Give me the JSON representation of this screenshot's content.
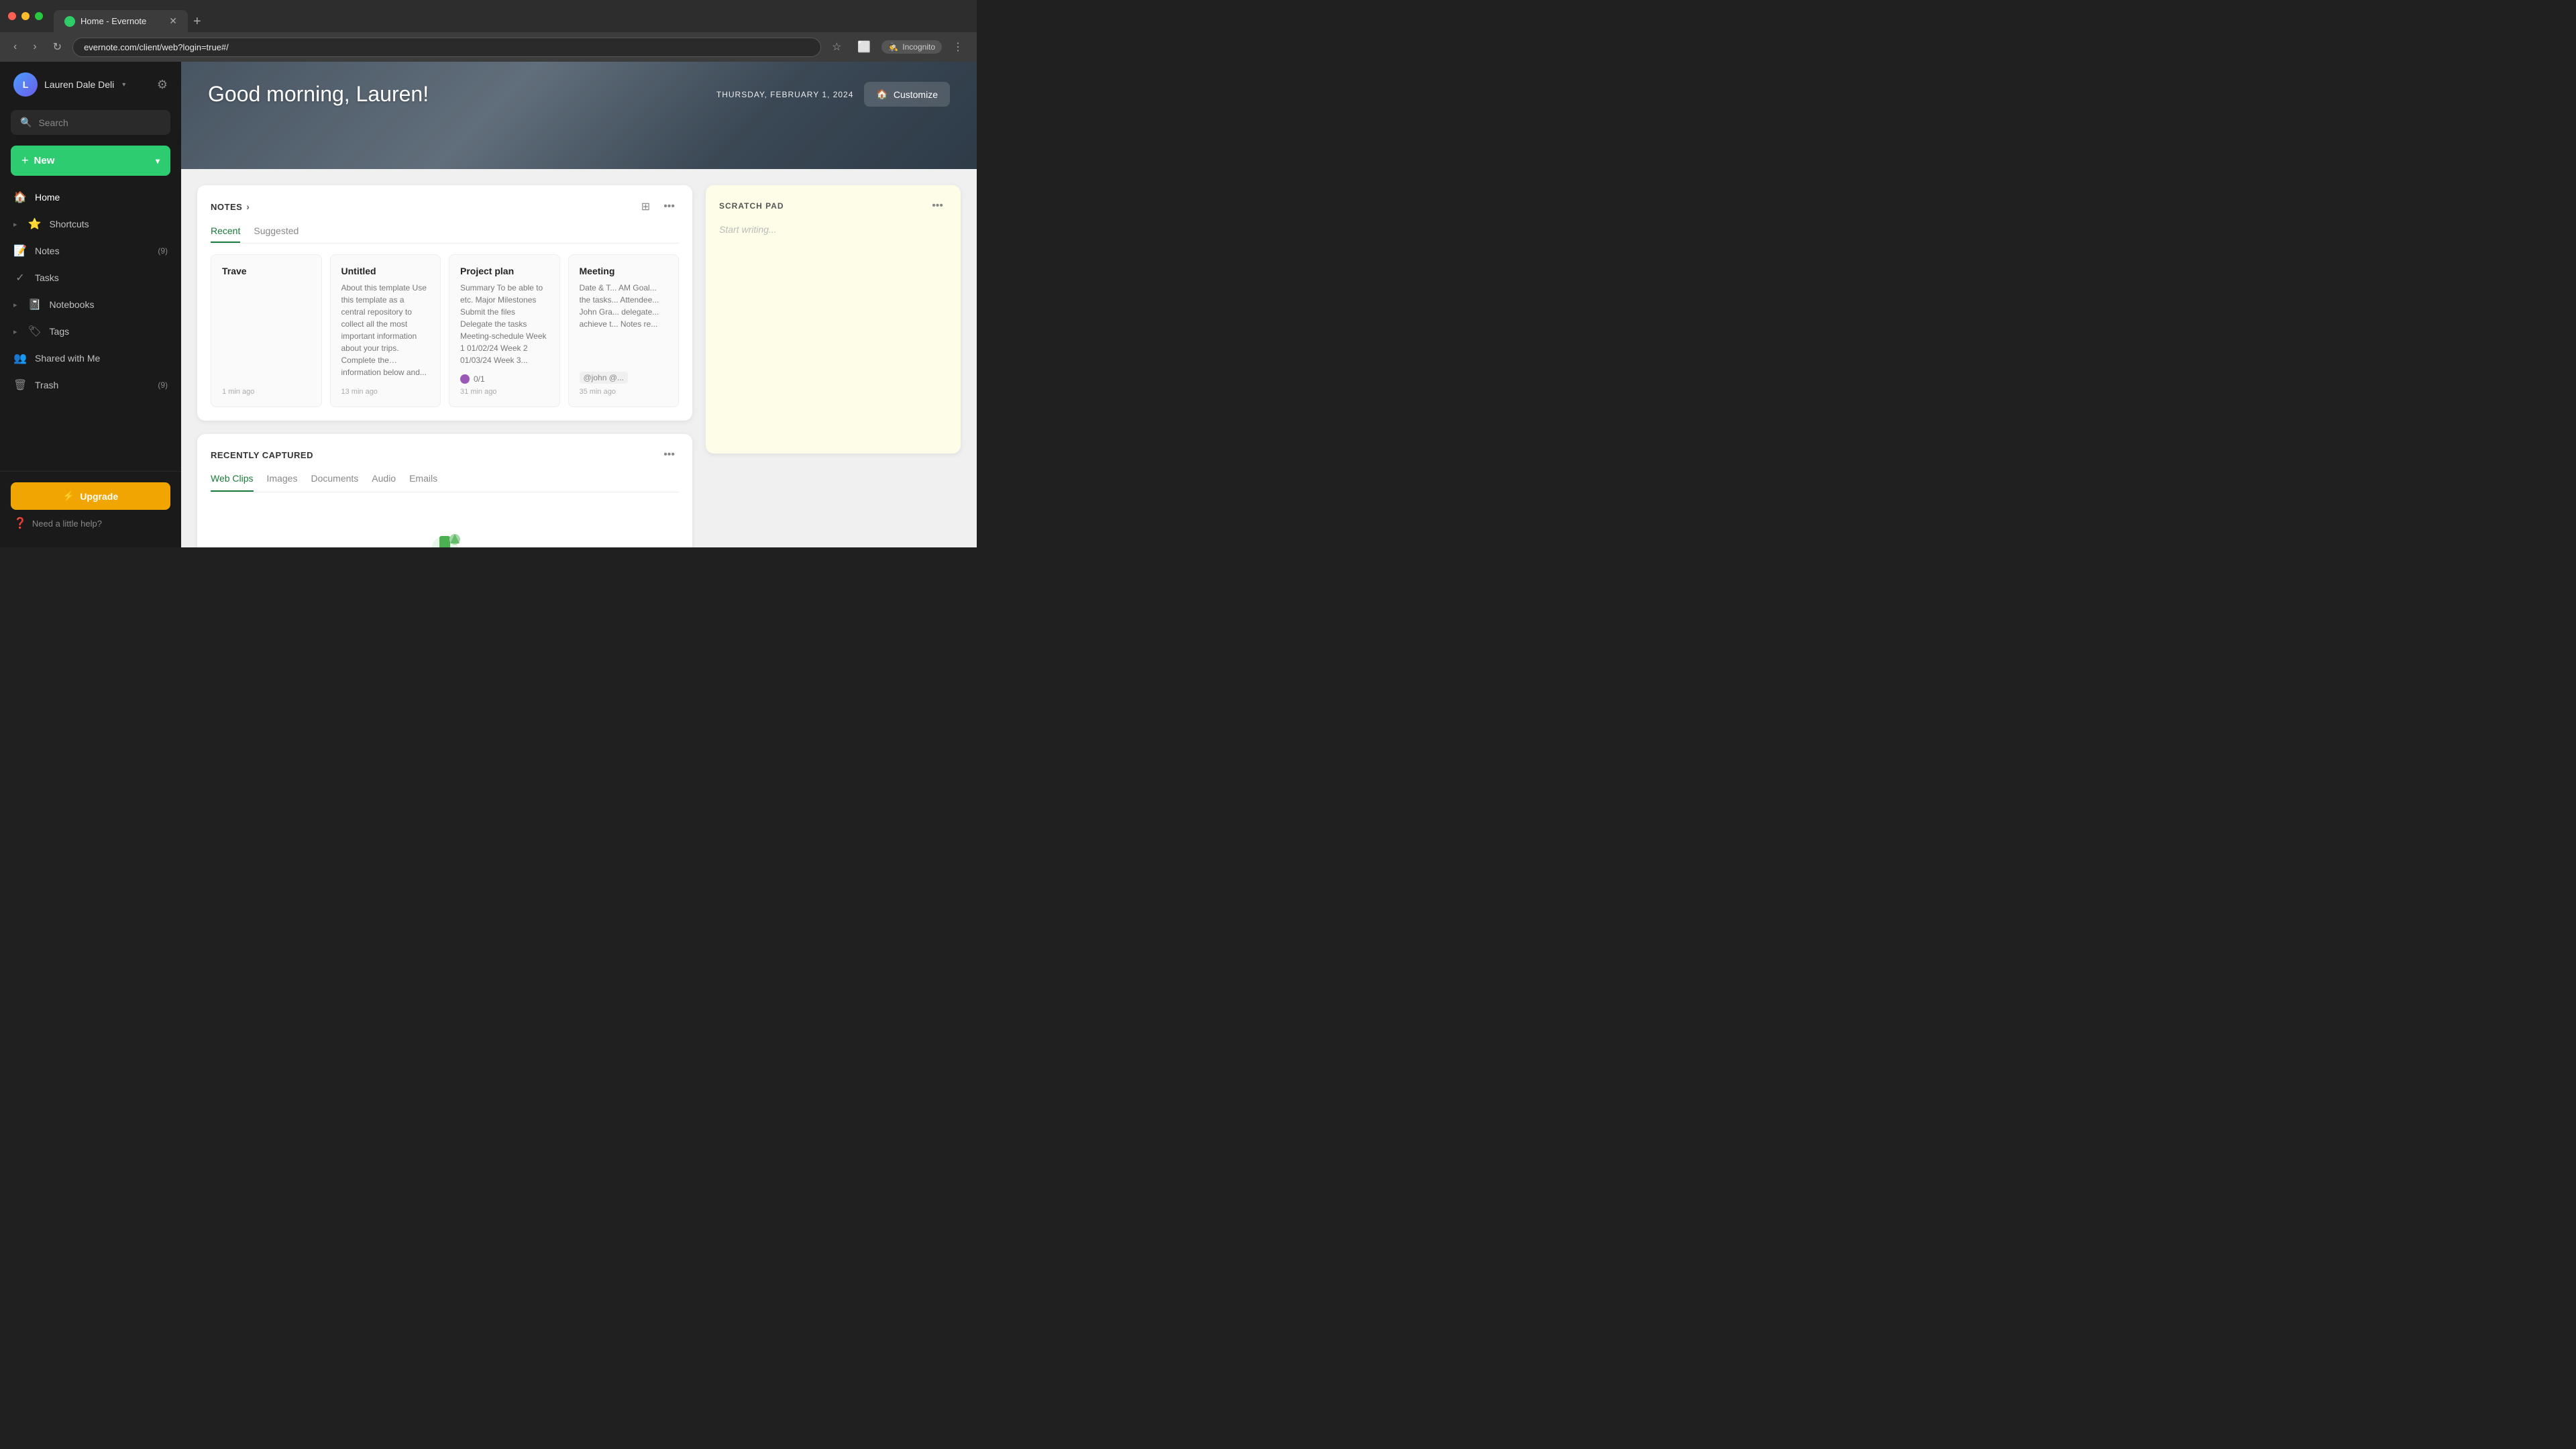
{
  "browser": {
    "tab_title": "Home - Evernote",
    "url": "evernote.com/client/web?login=true#/",
    "incognito_label": "Incognito"
  },
  "sidebar": {
    "user_name": "Lauren Dale Deli",
    "search_placeholder": "Search",
    "new_button_label": "New",
    "nav_items": [
      {
        "id": "home",
        "label": "Home",
        "icon": "🏠",
        "count": ""
      },
      {
        "id": "shortcuts",
        "label": "Shortcuts",
        "icon": "⭐",
        "count": "",
        "chevron": true
      },
      {
        "id": "notes",
        "label": "Notes",
        "icon": "📝",
        "count": "9"
      },
      {
        "id": "tasks",
        "label": "Tasks",
        "icon": "✓",
        "count": ""
      },
      {
        "id": "notebooks",
        "label": "Notebooks",
        "icon": "📓",
        "count": "",
        "chevron": true
      },
      {
        "id": "tags",
        "label": "Tags",
        "icon": "🏷",
        "count": "",
        "chevron": true
      },
      {
        "id": "shared",
        "label": "Shared with Me",
        "icon": "👥",
        "count": ""
      },
      {
        "id": "trash",
        "label": "Trash",
        "icon": "🗑",
        "count": "9"
      }
    ],
    "upgrade_label": "Upgrade",
    "help_label": "Need a little help?"
  },
  "hero": {
    "greeting": "Good morning, Lauren!",
    "date": "THURSDAY, FEBRUARY 1, 2024",
    "customize_label": "Customize"
  },
  "notes_widget": {
    "title": "NOTES",
    "tab_recent": "Recent",
    "tab_suggested": "Suggested",
    "cards": [
      {
        "title": "Trave",
        "preview": "",
        "time": "1 min ago"
      },
      {
        "title": "Untitled",
        "preview": "About this template\nUse this template as a central repository to collect all the most important information about your trips. Complete the information below and...",
        "time": "13 min ago"
      },
      {
        "title": "Project plan",
        "preview": "Summary To be able to etc. Major Milestones Submit the files Delegate the tasks Meeting-schedule Week 1 01/02/24 Week 2 01/03/24 Week 3...",
        "time": "31 min ago",
        "task": "0/1"
      },
      {
        "title": "Meeting",
        "preview": "Date & T... AM Goal... the tasks... Attendee... John Gra... delegate... achieve t... Notes re...",
        "time": "35 min ago",
        "mention": "@john @..."
      }
    ]
  },
  "scratch_pad": {
    "title": "SCRATCH PAD",
    "placeholder": "Start writing...",
    "more_icon": "•••"
  },
  "recently_captured": {
    "title": "RECENTLY CAPTURED",
    "tabs": [
      "Web Clips",
      "Images",
      "Documents",
      "Audio",
      "Emails"
    ],
    "active_tab": "Web Clips"
  }
}
